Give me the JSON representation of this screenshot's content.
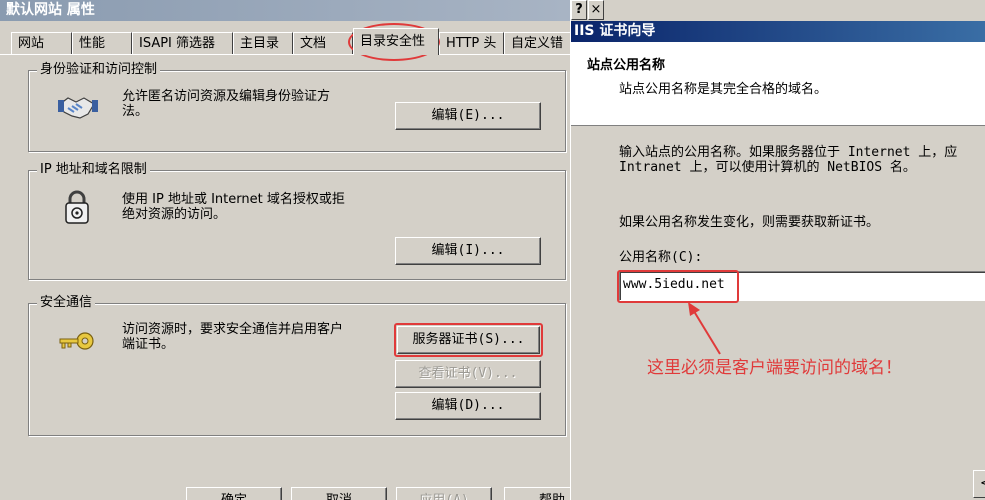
{
  "left_window": {
    "title": "默认网站 属性",
    "tabs": [
      {
        "label": "网站"
      },
      {
        "label": "性能"
      },
      {
        "label": "ISAPI 筛选器"
      },
      {
        "label": "主目录"
      },
      {
        "label": "文档"
      },
      {
        "label": "目录安全性"
      },
      {
        "label": "HTTP 头"
      },
      {
        "label": "自定义错"
      }
    ],
    "active_tab": "目录安全性",
    "groups": {
      "auth": {
        "title": "身份验证和访问控制",
        "desc_line1": "允许匿名访问资源及编辑身份验证方",
        "desc_line2": "法。",
        "edit_label": "编辑(E)...",
        "icon": "handshake-icon"
      },
      "ip": {
        "title": "IP 地址和域名限制",
        "desc_line1": "使用 IP 地址或 Internet 域名授权或拒",
        "desc_line2": "绝对资源的访问。",
        "edit_label": "编辑(I)...",
        "icon": "padlock-icon"
      },
      "secure": {
        "title": "安全通信",
        "desc_line1": "访问资源时，要求安全通信并启用客户",
        "desc_line2": "端证书。",
        "server_cert_label": "服务器证书(S)...",
        "view_cert_label": "查看证书(V)...",
        "edit_label": "编辑(D)...",
        "icon": "key-icon"
      }
    },
    "bottom_buttons": {
      "ok": "确定",
      "cancel": "取消",
      "apply": "应用(A)",
      "help": "帮助"
    }
  },
  "right_window": {
    "title": "IIS 证书向导",
    "help_button": "?",
    "close_button": "×",
    "header_title": "站点公用名称",
    "header_subtitle": "站点公用名称是其完全合格的域名。",
    "body_line1": "输入站点的公用名称。如果服务器位于 Internet 上，应",
    "body_line2": "Intranet 上，可以使用计算机的 NetBIOS 名。",
    "body_line3": "如果公用名称发生变化，则需要获取新证书。",
    "field_label": "公用名称(C):",
    "field_value": "www.5iedu.net",
    "annotation": "这里必须是客户端要访问的域名！",
    "back_button": "<"
  },
  "colors": {
    "annotation_red": "#e03a3a",
    "dialog_gray": "#d4d0c8",
    "active_title": "#0a246a"
  }
}
